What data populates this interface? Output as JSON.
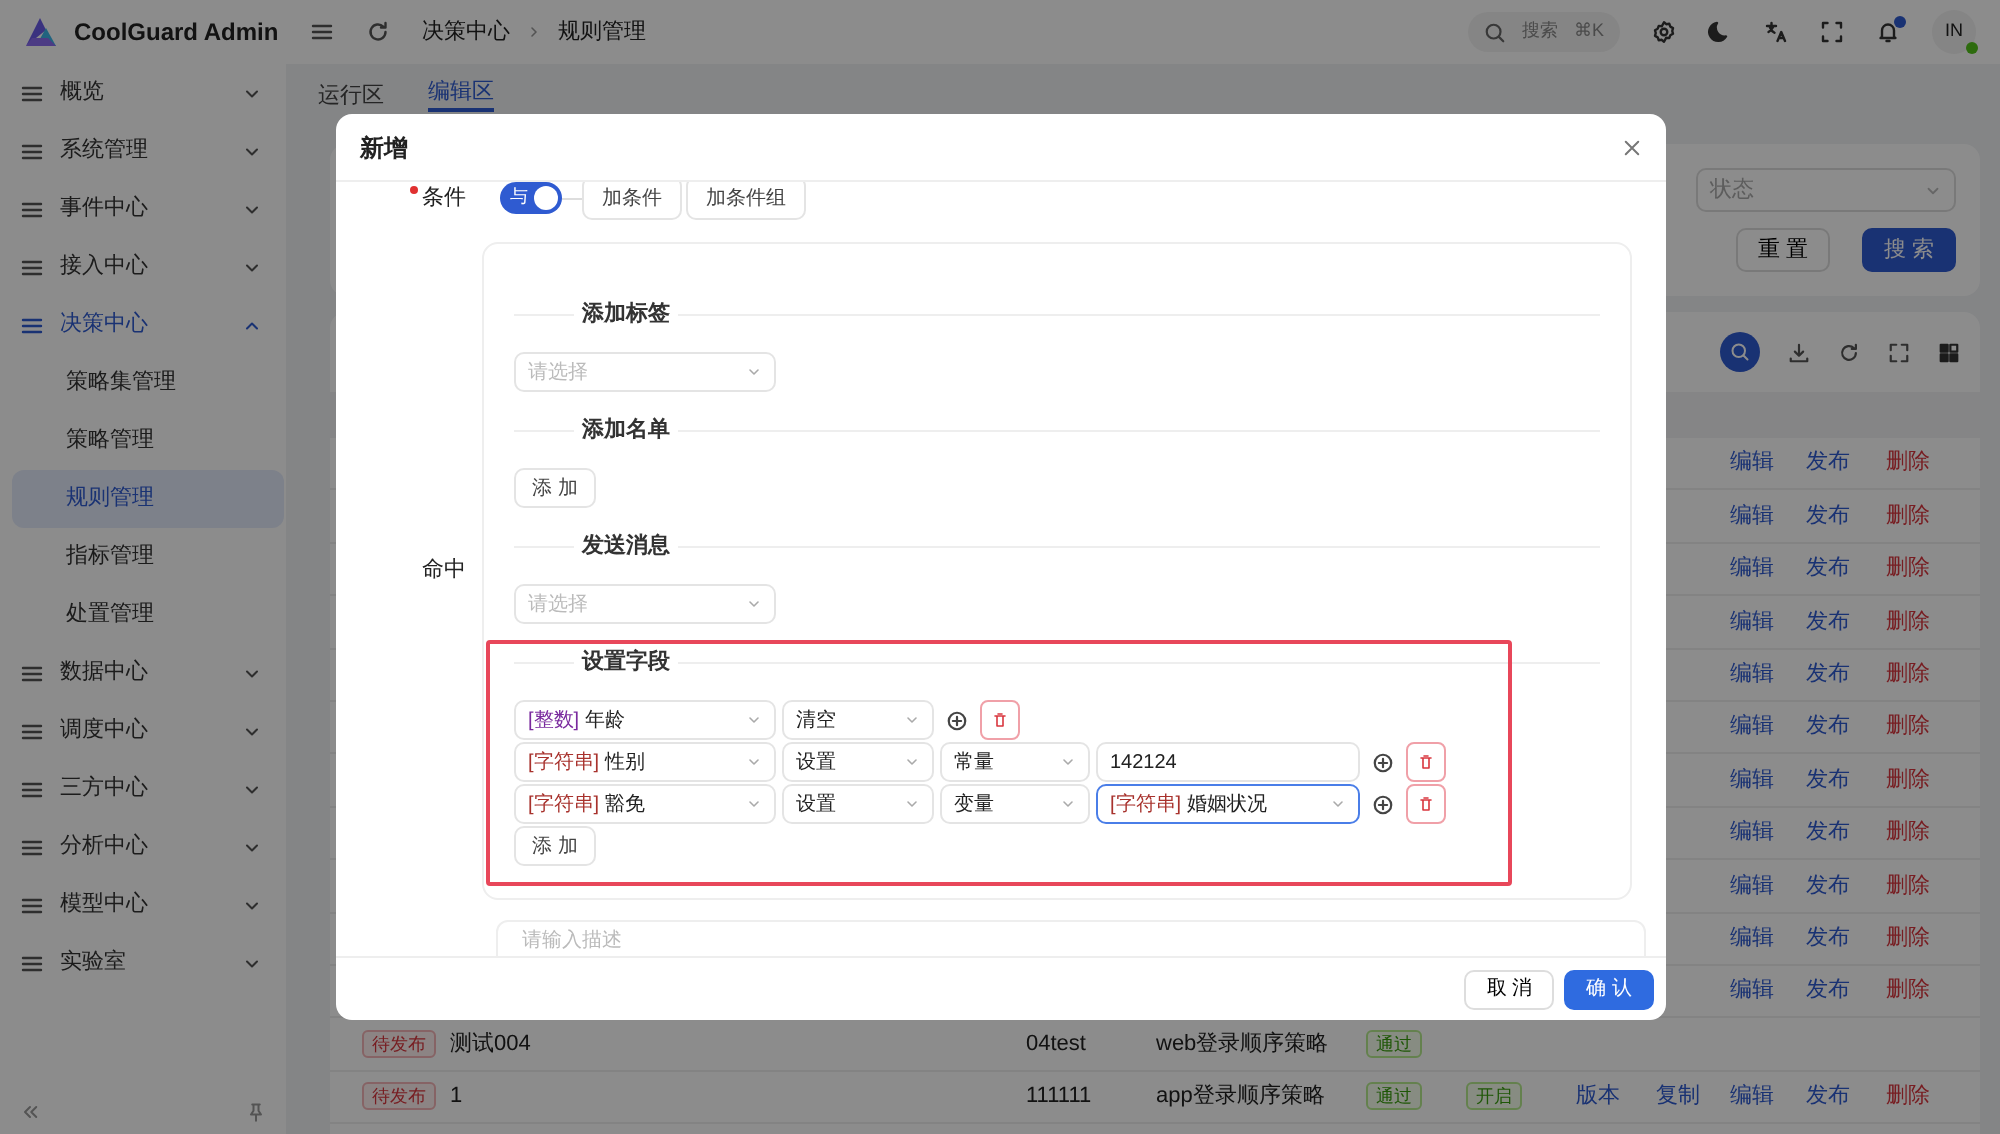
{
  "sidebar": {
    "brand": "CoolGuard Admin",
    "items": [
      {
        "label": "概览",
        "expanded": false
      },
      {
        "label": "系统管理",
        "expanded": false
      },
      {
        "label": "事件中心",
        "expanded": false
      },
      {
        "label": "接入中心",
        "expanded": false
      },
      {
        "label": "决策中心",
        "expanded": true,
        "children": [
          {
            "label": "策略集管理",
            "selected": false
          },
          {
            "label": "策略管理",
            "selected": false
          },
          {
            "label": "规则管理",
            "selected": true
          },
          {
            "label": "指标管理",
            "selected": false
          },
          {
            "label": "处置管理",
            "selected": false
          }
        ]
      },
      {
        "label": "数据中心",
        "expanded": false
      },
      {
        "label": "调度中心",
        "expanded": false
      },
      {
        "label": "三方中心",
        "expanded": false
      },
      {
        "label": "分析中心",
        "expanded": false
      },
      {
        "label": "模型中心",
        "expanded": false
      },
      {
        "label": "实验室",
        "expanded": false
      }
    ]
  },
  "header": {
    "breadcrumbs": [
      "决策中心",
      "规则管理"
    ],
    "search": {
      "placeholder": "搜索",
      "shortcut": "⌘K"
    },
    "unread": true,
    "avatar": "IN",
    "online": true
  },
  "tabs": [
    {
      "label": "运行区",
      "selected": false
    },
    {
      "label": "编辑区",
      "selected": true
    }
  ],
  "filters": {
    "status_placeholder": "状态",
    "buttons": [
      {
        "label": "重 置",
        "kind": "default"
      },
      {
        "label": "搜 索",
        "kind": "primary"
      }
    ]
  },
  "table": {
    "rows": [
      {
        "actions": [
          {
            "label": "编辑",
            "kind": "link"
          },
          {
            "label": "发布",
            "kind": "link"
          },
          {
            "label": "删除",
            "kind": "danger"
          }
        ]
      },
      {
        "actions": [
          {
            "label": "编辑",
            "kind": "link"
          },
          {
            "label": "发布",
            "kind": "link"
          },
          {
            "label": "删除",
            "kind": "danger"
          }
        ]
      },
      {
        "actions": [
          {
            "label": "编辑",
            "kind": "link"
          },
          {
            "label": "发布",
            "kind": "link"
          },
          {
            "label": "删除",
            "kind": "danger"
          }
        ]
      },
      {
        "actions": [
          {
            "label": "编辑",
            "kind": "link"
          },
          {
            "label": "发布",
            "kind": "link"
          },
          {
            "label": "删除",
            "kind": "danger"
          }
        ]
      },
      {
        "actions": [
          {
            "label": "编辑",
            "kind": "link"
          },
          {
            "label": "发布",
            "kind": "link"
          },
          {
            "label": "删除",
            "kind": "danger"
          }
        ]
      },
      {
        "actions": [
          {
            "label": "编辑",
            "kind": "link"
          },
          {
            "label": "发布",
            "kind": "link"
          },
          {
            "label": "删除",
            "kind": "danger"
          }
        ]
      },
      {
        "actions": [
          {
            "label": "编辑",
            "kind": "link"
          },
          {
            "label": "发布",
            "kind": "link"
          },
          {
            "label": "删除",
            "kind": "danger"
          }
        ]
      },
      {
        "actions": [
          {
            "label": "编辑",
            "kind": "link"
          },
          {
            "label": "发布",
            "kind": "link"
          },
          {
            "label": "删除",
            "kind": "danger"
          }
        ]
      },
      {
        "actions": [
          {
            "label": "编辑",
            "kind": "link"
          },
          {
            "label": "发布",
            "kind": "link"
          },
          {
            "label": "删除",
            "kind": "danger"
          }
        ]
      },
      {
        "actions": [
          {
            "label": "编辑",
            "kind": "link"
          },
          {
            "label": "发布",
            "kind": "link"
          },
          {
            "label": "删除",
            "kind": "danger"
          }
        ]
      },
      {
        "actions": [
          {
            "label": "编辑",
            "kind": "link"
          },
          {
            "label": "发布",
            "kind": "link"
          },
          {
            "label": "删除",
            "kind": "danger"
          }
        ]
      },
      {
        "status": "待发布",
        "name": "测试004",
        "code": "04test",
        "strategy": "web登录顺序策略",
        "audit": "通过"
      },
      {
        "status": "待发布",
        "name": "1",
        "code": "111111",
        "strategy": "app登录顺序策略",
        "audit": "通过",
        "enabled": "开启",
        "actions": [
          {
            "label": "版本",
            "kind": "link"
          },
          {
            "label": "复制",
            "kind": "link"
          },
          {
            "label": "编辑",
            "kind": "link"
          },
          {
            "label": "发布",
            "kind": "link"
          },
          {
            "label": "删除",
            "kind": "danger"
          }
        ]
      }
    ]
  },
  "modal": {
    "title": "新增",
    "condition": {
      "label": "条件",
      "required": true,
      "logic": "与",
      "on": true,
      "buttons": [
        "加条件",
        "加条件组"
      ]
    },
    "hit": {
      "label": "命中",
      "sections": [
        {
          "kind": "select",
          "title": "添加标签",
          "placeholder": "请选择"
        },
        {
          "kind": "button",
          "title": "添加名单",
          "button": "添 加"
        },
        {
          "kind": "select",
          "title": "发送消息",
          "placeholder": "请选择"
        },
        {
          "kind": "fields",
          "title": "设置字段",
          "highlighted": true,
          "button": "添 加",
          "rows": [
            {
              "field": {
                "type": "[整数]",
                "name": "年龄",
                "color": "#7a2a9e"
              },
              "op": "清空"
            },
            {
              "field": {
                "type": "[字符串]",
                "name": "性别",
                "color": "#a8322d"
              },
              "op": "设置",
              "source": "常量",
              "value": {
                "kind": "input",
                "text": "142124",
                "focused": false
              }
            },
            {
              "field": {
                "type": "[字符串]",
                "name": "豁免",
                "color": "#a8322d"
              },
              "op": "设置",
              "source": "变量",
              "value": {
                "kind": "select",
                "type": "[字符串]",
                "color": "#a8322d",
                "text": "婚姻状况",
                "focused": true
              }
            }
          ]
        }
      ]
    },
    "description": {
      "placeholder": "请输入描述"
    },
    "buttons": [
      {
        "label": "取 消",
        "kind": "default"
      },
      {
        "label": "确 认",
        "kind": "primary"
      }
    ]
  }
}
